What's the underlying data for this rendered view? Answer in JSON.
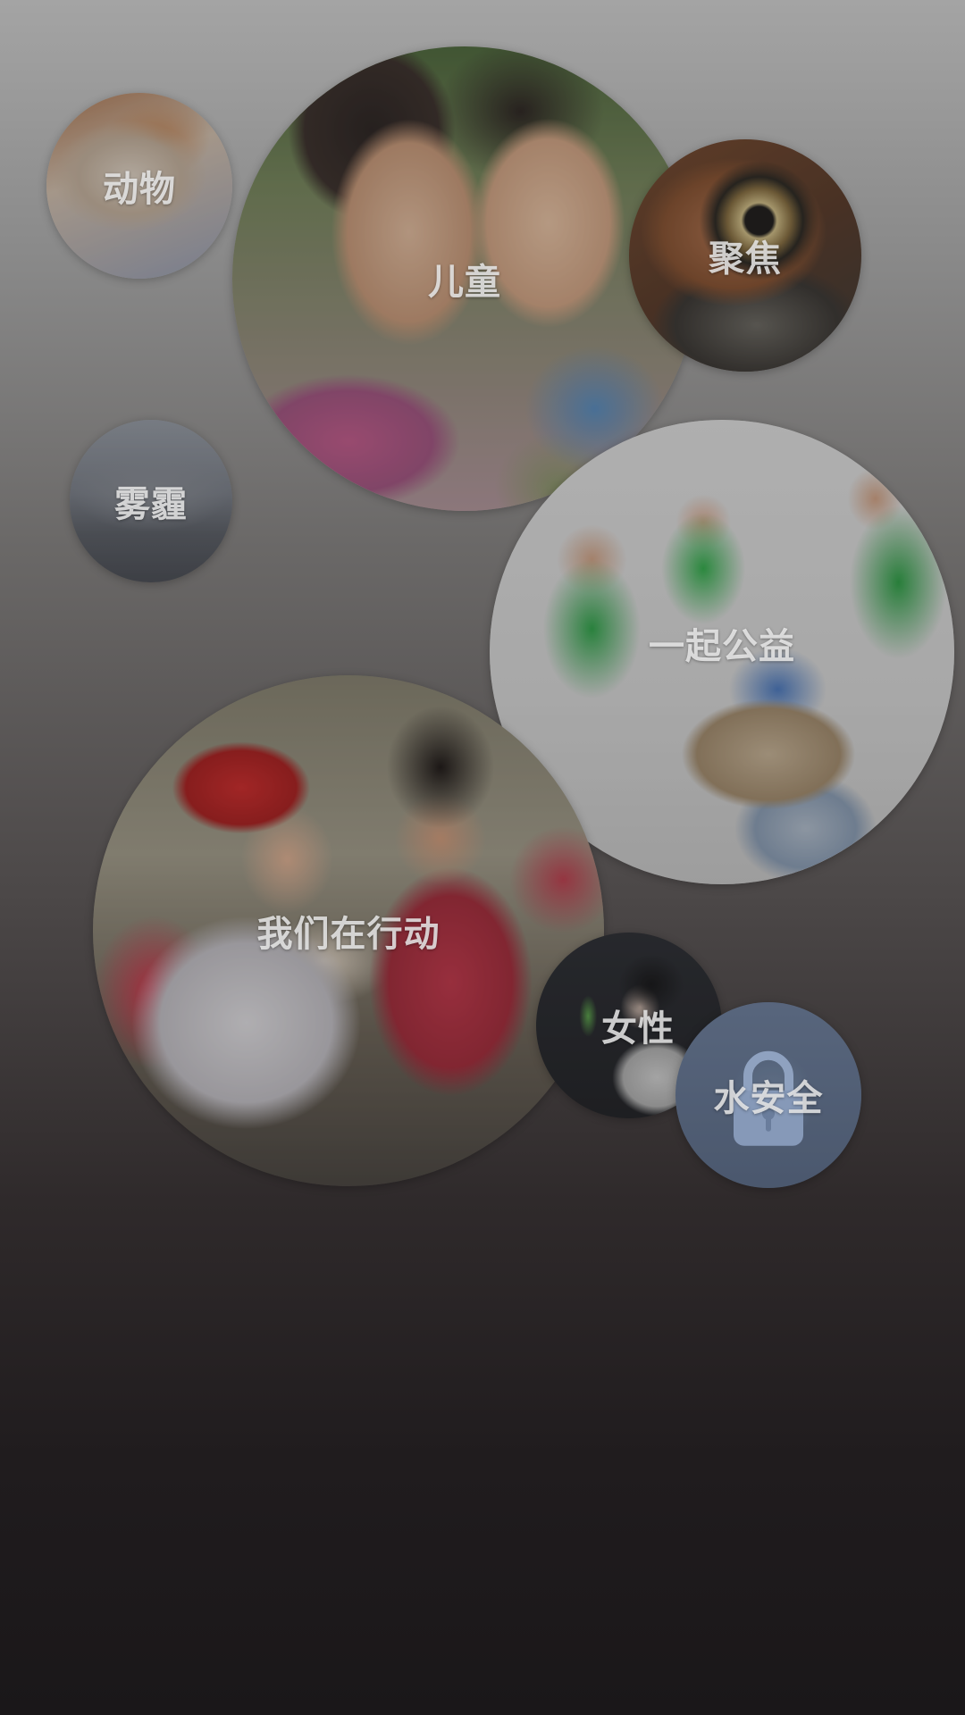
{
  "categories": [
    {
      "id": "animal",
      "label": "动物"
    },
    {
      "id": "children",
      "label": "儿童"
    },
    {
      "id": "focus",
      "label": "聚焦"
    },
    {
      "id": "haze",
      "label": "雾霾"
    },
    {
      "id": "charity",
      "label": "一起公益"
    },
    {
      "id": "action",
      "label": "我们在行动"
    },
    {
      "id": "women",
      "label": "女性"
    },
    {
      "id": "water",
      "label": "水安全"
    }
  ],
  "colors": {
    "background_top": "#a4a4a4",
    "background_bottom": "#1a1719",
    "label_text": "#ebebeb"
  },
  "icons": {
    "water": "padlock-icon"
  }
}
